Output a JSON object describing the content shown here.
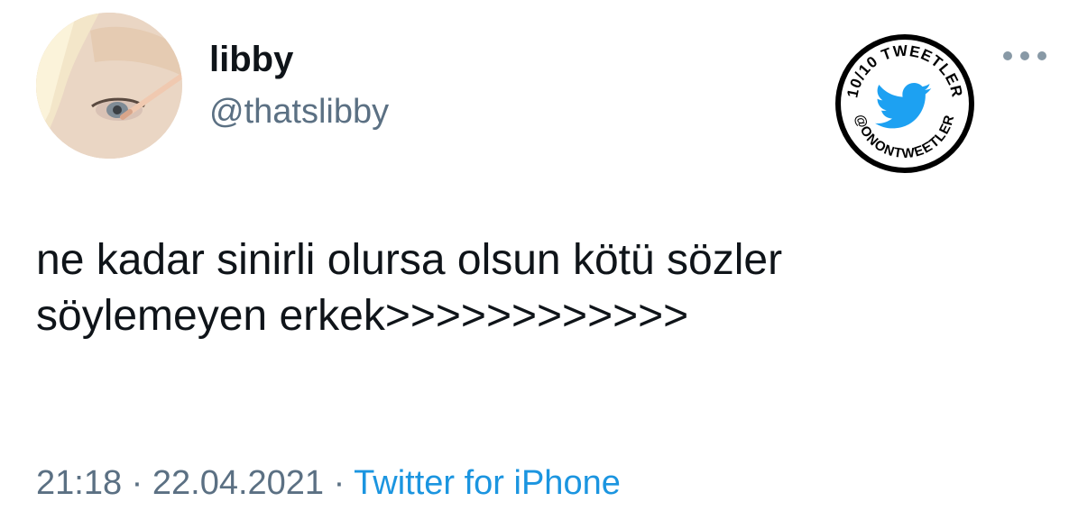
{
  "author": {
    "display_name": "libby",
    "handle": "@thatslibby"
  },
  "badge": {
    "top_text": "10/10 TWEETLER",
    "bottom_text": "@ONONTWEETLER",
    "icon": "twitter-bird-icon",
    "bird_color": "#1da1f2"
  },
  "more_menu": {
    "icon": "more-dots-icon"
  },
  "tweet": {
    "text": "ne kadar sinirli olursa olsun kötü sözler\nsöylemeyen erkek>>>>>>>>>>>>"
  },
  "meta": {
    "time": "21:18",
    "separator": " · ",
    "date": "22.04.2021",
    "source": "Twitter for iPhone"
  },
  "colors": {
    "text": "#0f1419",
    "secondary": "#5b7083",
    "link": "#1b95e0"
  }
}
